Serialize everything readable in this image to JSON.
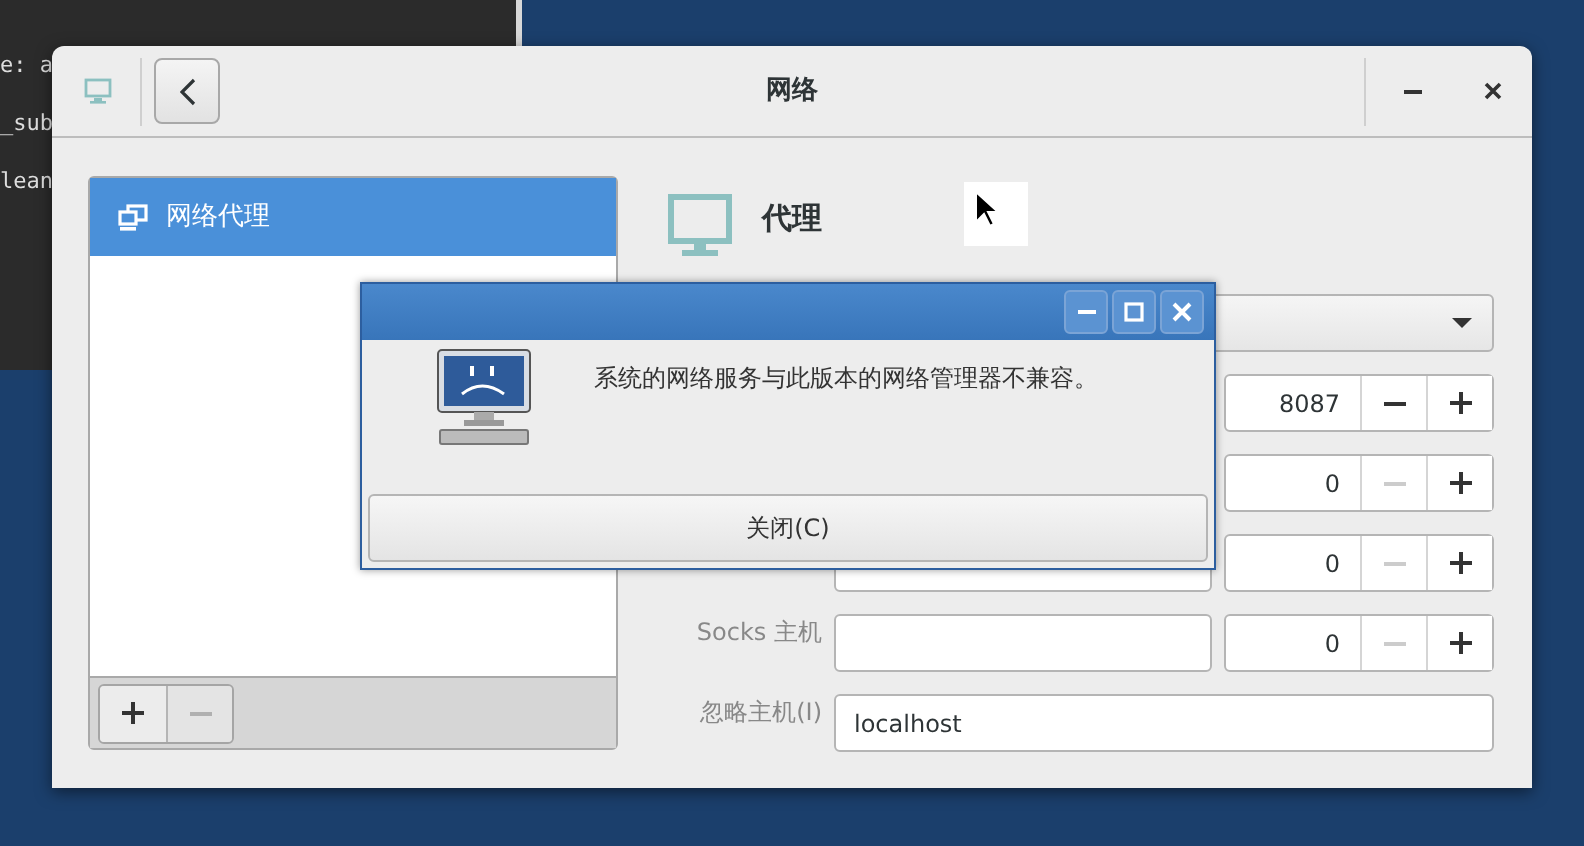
{
  "terminal": {
    "lines": [
      "e: a",
      "_sub",
      "lean"
    ]
  },
  "window": {
    "title": "网络"
  },
  "sidebar": {
    "items": [
      {
        "label": "网络代理",
        "selected": true
      }
    ],
    "remove_disabled": true
  },
  "panel": {
    "title": "代理"
  },
  "form": {
    "rows": [
      {
        "kind": "combo"
      },
      {
        "kind": "port",
        "port": "8087",
        "decrement_disabled": false
      },
      {
        "kind": "port",
        "port": "0",
        "decrement_disabled": true
      },
      {
        "kind": "host_port",
        "port": "0",
        "decrement_disabled": true
      },
      {
        "kind": "host_port",
        "label": "Socks 主机",
        "port": "0",
        "decrement_disabled": true
      },
      {
        "kind": "text",
        "label": "忽略主机(I)",
        "value": "localhost"
      }
    ]
  },
  "dialog": {
    "message": "系统的网络服务与此版本的网络管理器不兼容。",
    "button": "关闭(C)"
  }
}
